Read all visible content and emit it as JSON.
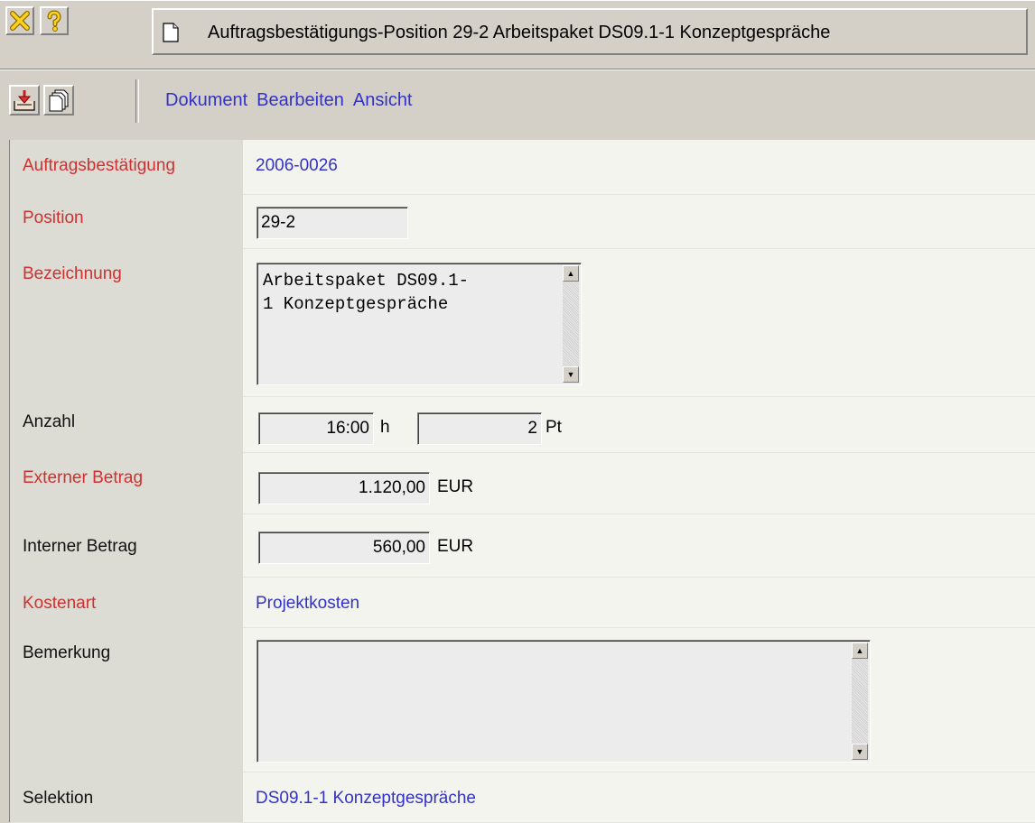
{
  "window": {
    "title": "Auftragsbestätigungs-Position 29-2 Arbeitspaket DS09.1-1 Konzeptgespräche",
    "close_icon": "close-x-icon",
    "help_icon": "question-mark-icon",
    "doc_icon": "document-icon"
  },
  "toolbar": {
    "save_icon": "save-tray-icon",
    "copy_icon": "copy-pages-icon",
    "menu": [
      "Dokument",
      "Bearbeiten",
      "Ansicht"
    ]
  },
  "form": {
    "auftragsbestaetigung": {
      "label": "Auftragsbestätigung",
      "value": "2006-0026"
    },
    "position": {
      "label": "Position",
      "value": "29-2"
    },
    "bezeichnung": {
      "label": "Bezeichnung",
      "value": "Arbeitspaket DS09.1-\n1 Konzeptgespräche"
    },
    "anzahl": {
      "label": "Anzahl",
      "hours": "16:00",
      "hours_unit": "h",
      "points": "2",
      "points_unit": "Pt"
    },
    "externer_betrag": {
      "label": "Externer Betrag",
      "value": "1.120,00",
      "unit": "EUR"
    },
    "interner_betrag": {
      "label": "Interner Betrag",
      "value": "560,00",
      "unit": "EUR"
    },
    "kostenart": {
      "label": "Kostenart",
      "value": "Projektkosten"
    },
    "bemerkung": {
      "label": "Bemerkung",
      "value": ""
    },
    "selektion": {
      "label": "Selektion",
      "value": "DS09.1-1 Konzeptgespräche"
    }
  },
  "colors": {
    "required_label": "#d03030",
    "link": "#3232c8"
  }
}
